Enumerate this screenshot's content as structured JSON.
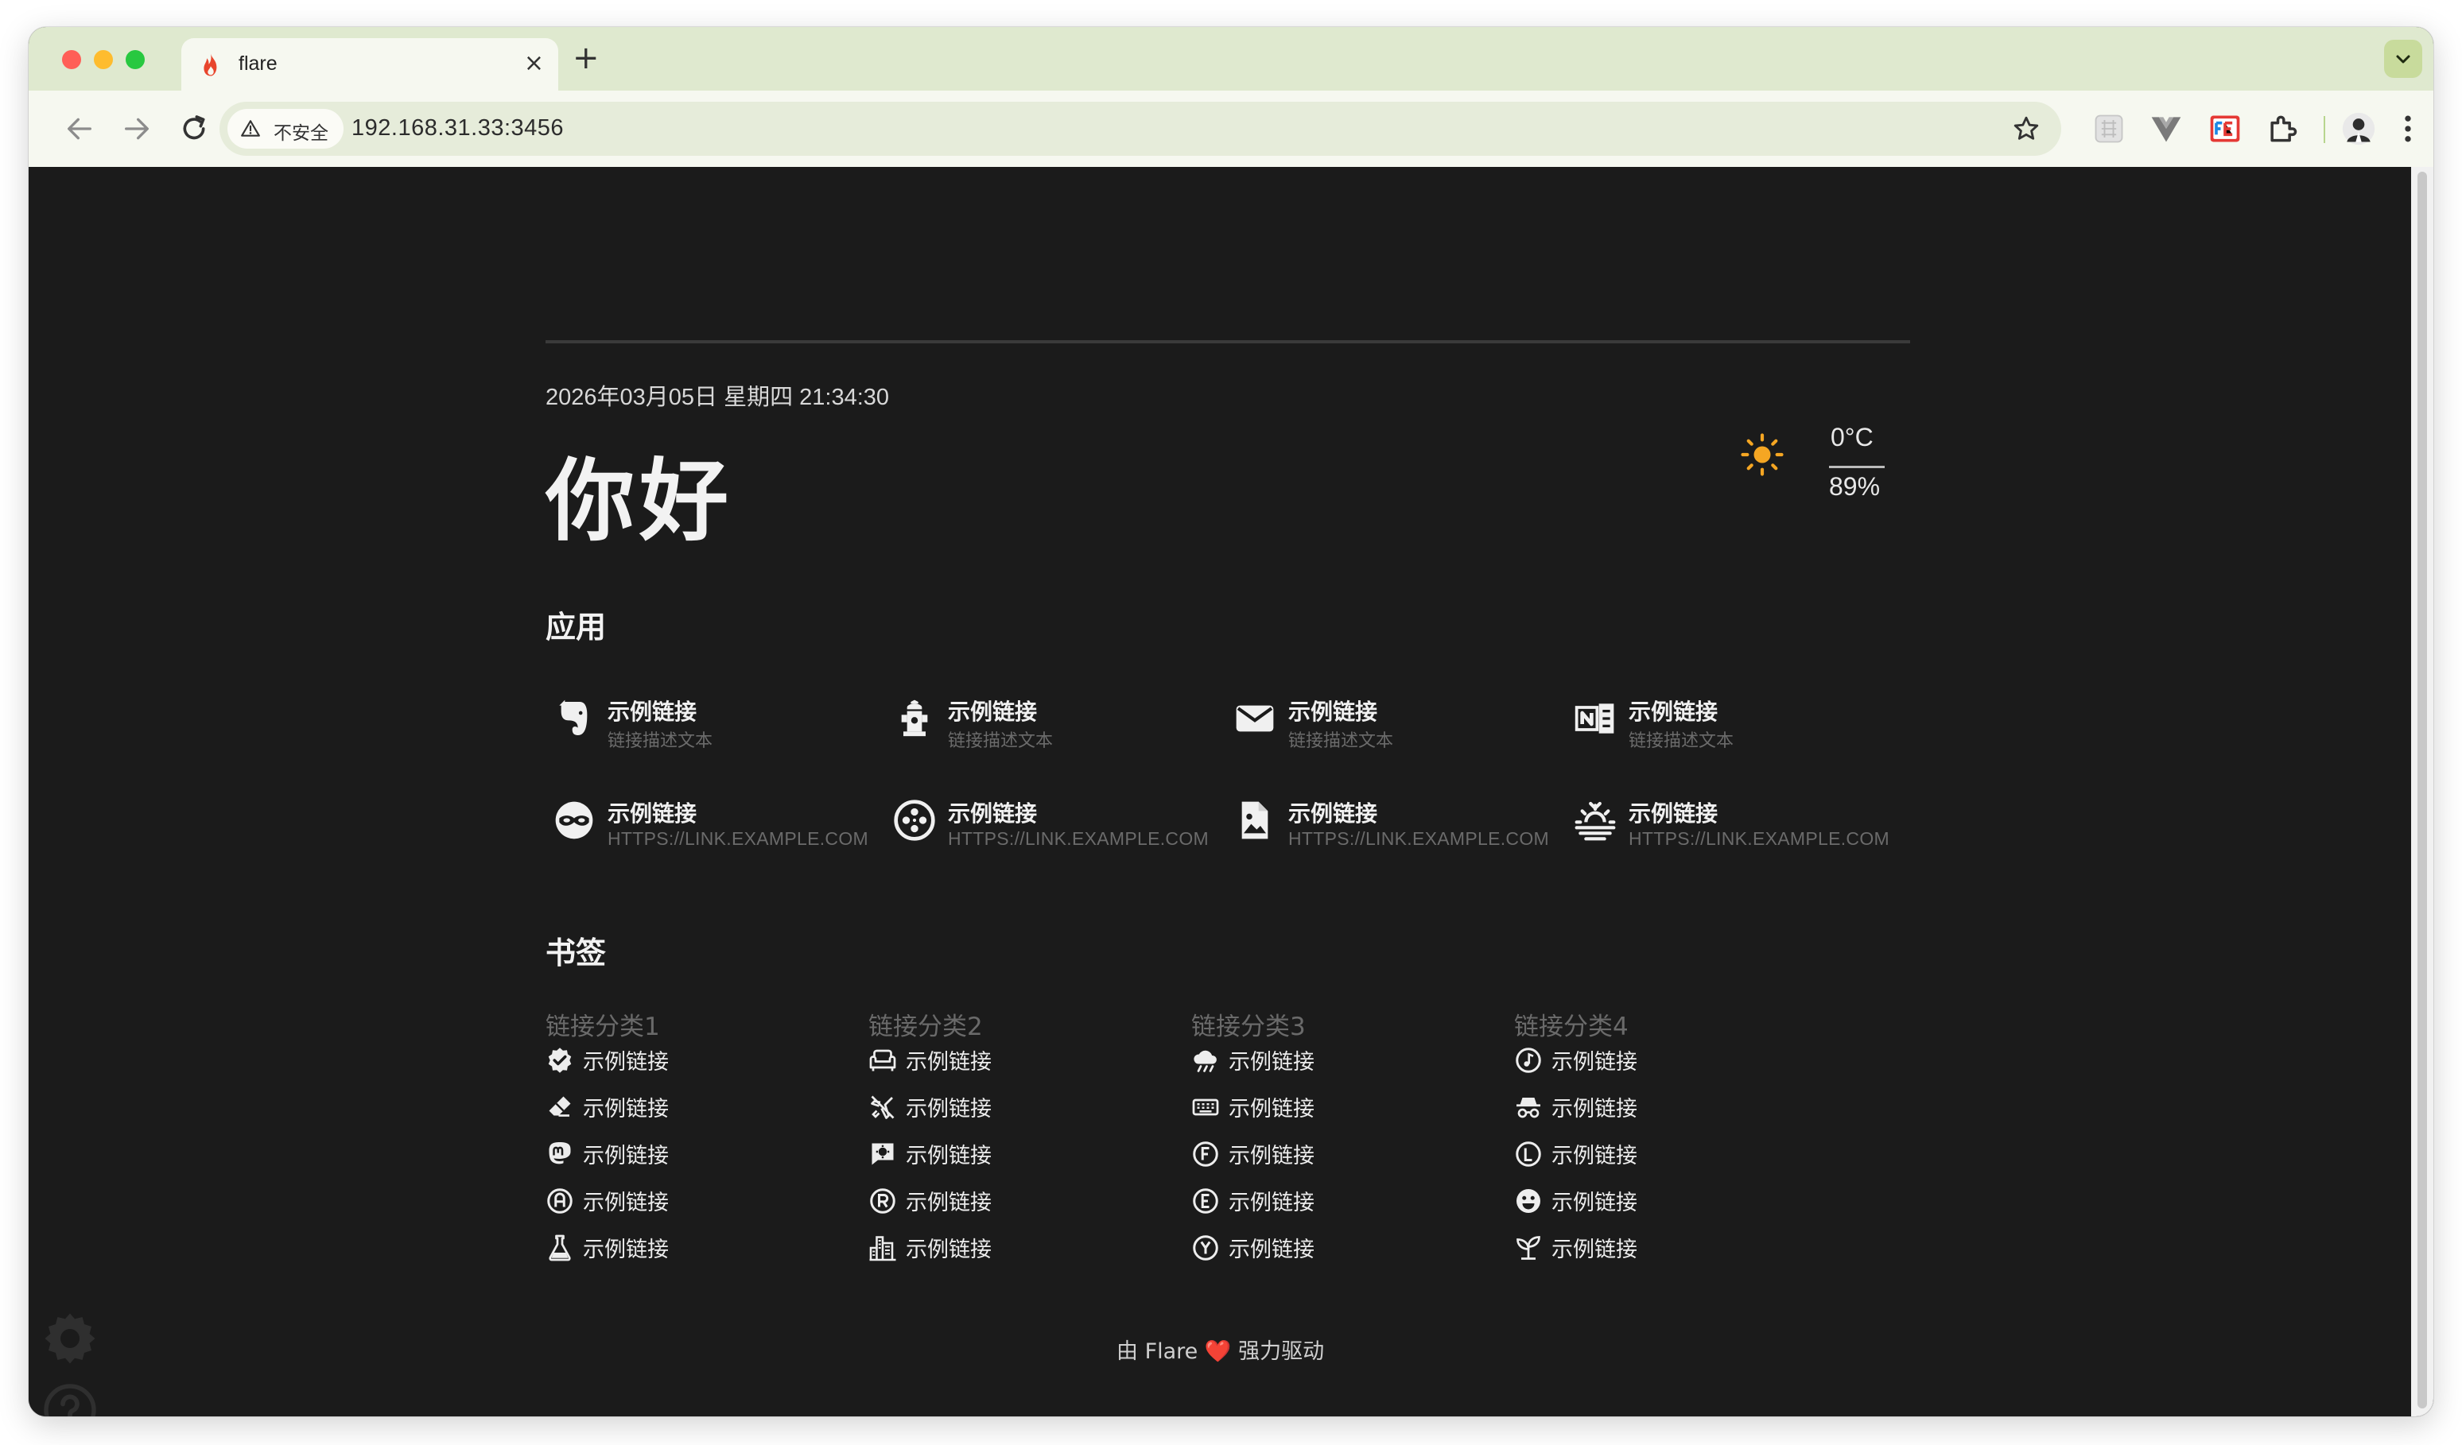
{
  "browser": {
    "tab_title": "flare",
    "tab_close": "×",
    "new_tab": "+",
    "security_label": "不安全",
    "url": "192.168.31.33:3456"
  },
  "header": {
    "datetime": "2026年03月05日 星期四 21:34:30",
    "greeting": "你好"
  },
  "weather": {
    "temperature": "0°C",
    "humidity": "89%",
    "icon": "sun-icon",
    "icon_color": "#f5a623"
  },
  "apps": {
    "title": "应用",
    "items": [
      {
        "name": "示例链接",
        "desc": "链接描述文本",
        "icon": "evernote-icon"
      },
      {
        "name": "示例链接",
        "desc": "链接描述文本",
        "icon": "fire-hydrant-icon"
      },
      {
        "name": "示例链接",
        "desc": "链接描述文本",
        "icon": "email-icon"
      },
      {
        "name": "示例链接",
        "desc": "链接描述文本",
        "icon": "onenote-icon"
      },
      {
        "name": "示例链接",
        "desc": "HTTPS://LINK.EXAMPLE.COM",
        "icon": "incognito-mask-icon"
      },
      {
        "name": "示例链接",
        "desc": "HTTPS://LINK.EXAMPLE.COM",
        "icon": "film-reel-icon"
      },
      {
        "name": "示例链接",
        "desc": "HTTPS://LINK.EXAMPLE.COM",
        "icon": "image-file-icon"
      },
      {
        "name": "示例链接",
        "desc": "HTTPS://LINK.EXAMPLE.COM",
        "icon": "sunset-icon"
      }
    ]
  },
  "bookmarks": {
    "title": "书签",
    "categories": [
      {
        "name": "链接分类1",
        "items": [
          {
            "label": "示例链接",
            "icon": "check-decagram-icon"
          },
          {
            "label": "示例链接",
            "icon": "eraser-icon"
          },
          {
            "label": "示例链接",
            "icon": "mastodon-icon"
          },
          {
            "label": "示例链接",
            "icon": "alpha-a-circle-icon"
          },
          {
            "label": "示例链接",
            "icon": "flask-icon"
          }
        ]
      },
      {
        "name": "链接分类2",
        "items": [
          {
            "label": "示例链接",
            "icon": "sofa-icon"
          },
          {
            "label": "示例链接",
            "icon": "airplane-off-icon"
          },
          {
            "label": "示例链接",
            "icon": "comment-alert-icon"
          },
          {
            "label": "示例链接",
            "icon": "alpha-r-circle-icon"
          },
          {
            "label": "示例链接",
            "icon": "city-icon"
          }
        ]
      },
      {
        "name": "链接分类3",
        "items": [
          {
            "label": "示例链接",
            "icon": "weather-rainy-icon"
          },
          {
            "label": "示例链接",
            "icon": "keyboard-icon"
          },
          {
            "label": "示例链接",
            "icon": "alpha-f-circle-icon"
          },
          {
            "label": "示例链接",
            "icon": "alpha-e-circle-icon"
          },
          {
            "label": "示例链接",
            "icon": "alpha-y-circle-icon"
          }
        ]
      },
      {
        "name": "链接分类4",
        "items": [
          {
            "label": "示例链接",
            "icon": "music-circle-icon"
          },
          {
            "label": "示例链接",
            "icon": "incognito-icon"
          },
          {
            "label": "示例链接",
            "icon": "alpha-l-circle-icon"
          },
          {
            "label": "示例链接",
            "icon": "emoticon-icon"
          },
          {
            "label": "示例链接",
            "icon": "sprout-icon"
          }
        ]
      }
    ]
  },
  "footer": {
    "prefix": "由 Flare",
    "heart": "❤️",
    "suffix": "强力驱动"
  }
}
